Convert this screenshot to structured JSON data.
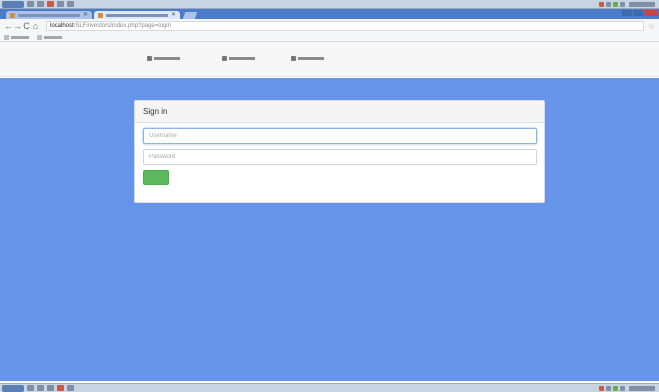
{
  "browser": {
    "address": {
      "host": "localhost",
      "path": "/SLFinvestors/index.php?page=login"
    }
  },
  "login_panel": {
    "title": "Sign in",
    "username_placeholder": "Username",
    "password_placeholder": "Password",
    "submit_label": ""
  },
  "colors": {
    "page_background": "#6594e8",
    "submit_button": "#5cb85c",
    "tab_strip": "#4a7cc9"
  }
}
